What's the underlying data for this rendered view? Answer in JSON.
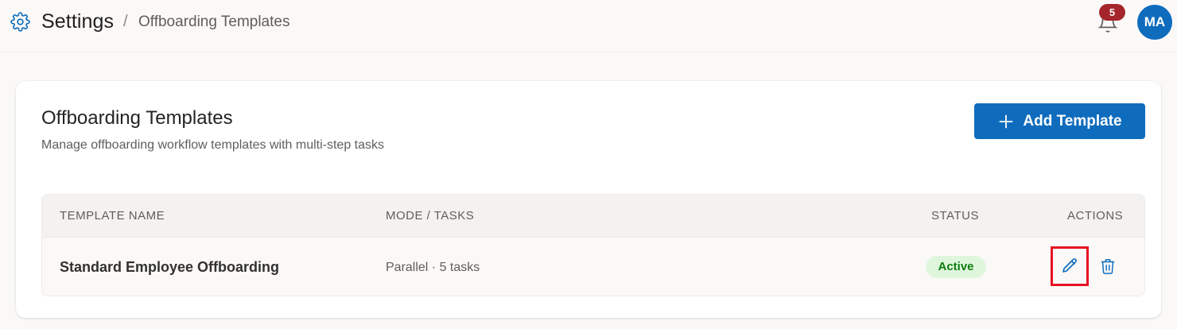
{
  "header": {
    "title": "Settings",
    "separator": "/",
    "page": "Offboarding Templates",
    "notification_count": "5",
    "avatar_initials": "MA",
    "icons": {
      "settings": "gear-icon",
      "notifications": "bell-icon"
    }
  },
  "card": {
    "title": "Offboarding Templates",
    "subtitle": "Manage offboarding workflow templates with multi-step tasks",
    "add_button_label": "Add Template",
    "add_button_icon": "plus-icon"
  },
  "table": {
    "columns": [
      "TEMPLATE NAME",
      "MODE / TASKS",
      "STATUS",
      "ACTIONS"
    ],
    "rows": [
      {
        "name": "Standard Employee Offboarding",
        "mode_tasks": "Parallel · 5 tasks",
        "status": "Active",
        "actions": [
          "pencil-icon",
          "trash-icon"
        ]
      }
    ]
  },
  "colors": {
    "accent": "#0f6cbd",
    "badge": "#a4262c",
    "status_active_bg": "#dff6dd",
    "status_active_text": "#107c10",
    "highlight": "#e81123"
  }
}
